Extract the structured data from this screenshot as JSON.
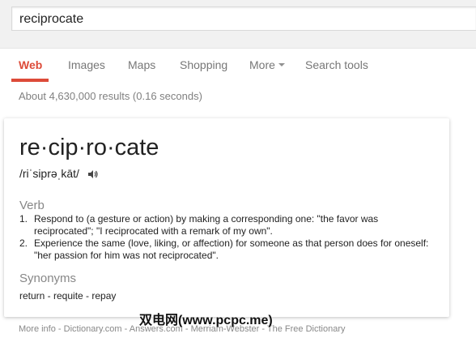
{
  "search": {
    "query": "reciprocate"
  },
  "tabs": [
    {
      "label": "Web"
    },
    {
      "label": "Images"
    },
    {
      "label": "Maps"
    },
    {
      "label": "Shopping"
    },
    {
      "label": "More"
    },
    {
      "label": "Search tools"
    }
  ],
  "result_stats": "About 4,630,000 results (0.16 seconds)",
  "definition": {
    "word": "re·cip·ro·cate",
    "pronunciation": "/riˈsiprəˌkāt/",
    "pos1": "Verb",
    "senses": [
      {
        "num": "1.",
        "text": "Respond to (a gesture or action) by making a corresponding one: \"the favor was reciprocated\"; \"I reciprocated with a remark of my own\"."
      },
      {
        "num": "2.",
        "text": "Experience the same (love, liking, or affection) for someone as that person does for oneself: \"her passion for him was not reciprocated\"."
      }
    ],
    "pos2": "Synonyms",
    "synonyms": "return - requite - repay"
  },
  "footer": {
    "more_info": "More info - ",
    "sources": [
      "Dictionary.com",
      "Answers.com",
      "Merriam-Webster",
      "The Free Dictionary"
    ],
    "sep": " - "
  },
  "watermark": "双电网(www.pcpc.me)",
  "colors": {
    "accent": "#dd4b39",
    "muted": "#777777",
    "pos_gray": "#878787"
  }
}
